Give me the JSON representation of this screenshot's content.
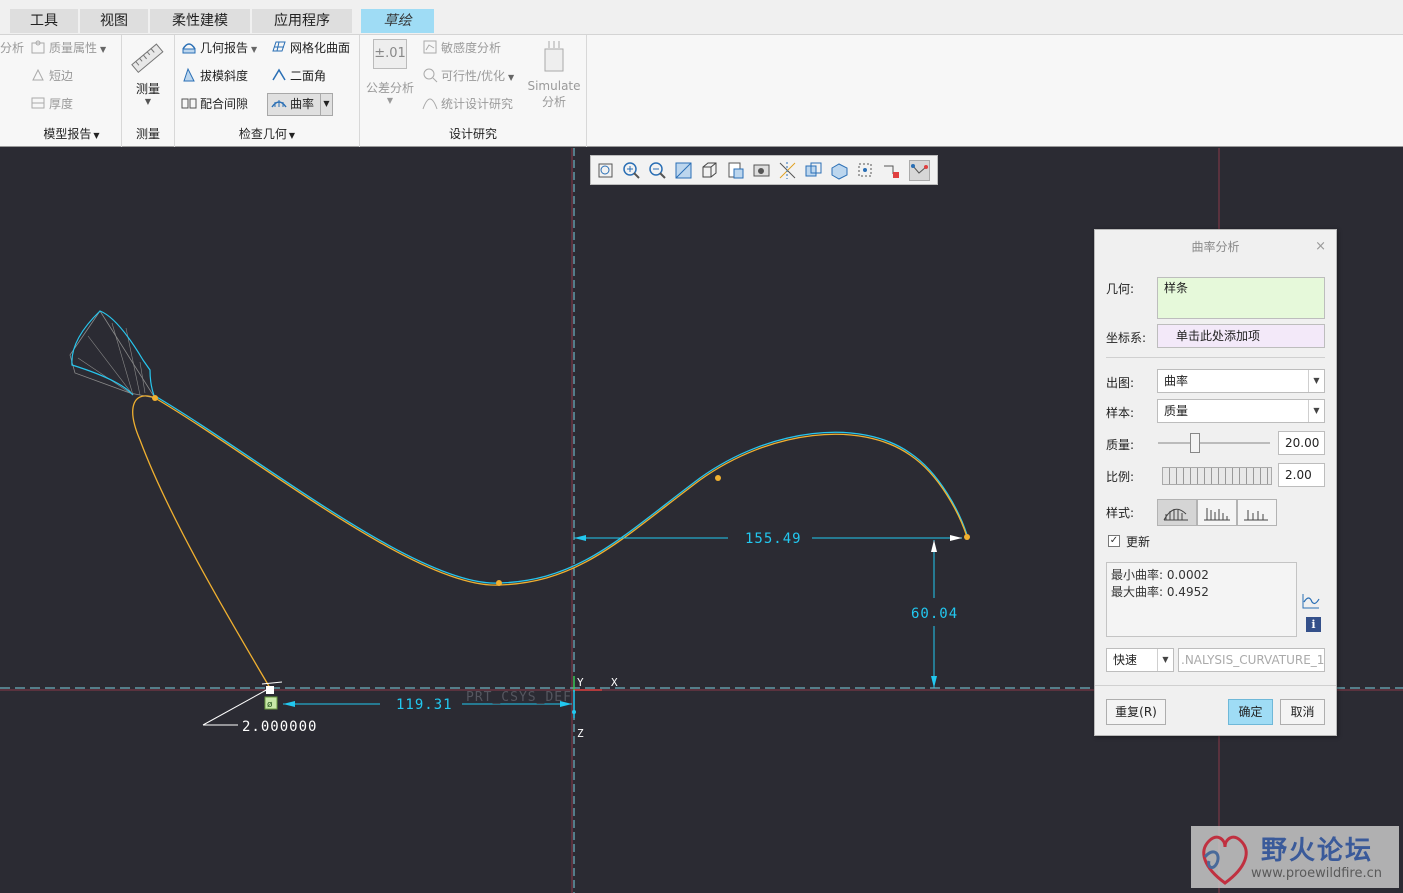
{
  "tabs": [
    {
      "label": "工具"
    },
    {
      "label": "视图"
    },
    {
      "label": "柔性建模"
    },
    {
      "label": "应用程序"
    },
    {
      "label": "草绘"
    }
  ],
  "ribbon": {
    "partial_left": "分析",
    "model_report": {
      "items": [
        "质量属性",
        "短边",
        "厚度"
      ],
      "label": "模型报告"
    },
    "measure": {
      "button": "测量",
      "label": "测量"
    },
    "inspect_geometry": {
      "items": [
        "几何报告",
        "拔模斜度",
        "配合间隙",
        "网格化曲面",
        "二面角",
        "曲率"
      ],
      "label": "检查几何"
    },
    "design_study": {
      "tolerance_icon": "±.01",
      "tolerance": "公差分析",
      "items": [
        "敏感度分析",
        "可行性/优化",
        "统计设计研究"
      ],
      "simulate_line1": "Simulate",
      "simulate_line2": "分析",
      "label": "设计研究"
    }
  },
  "canvas": {
    "dim_horizontal": "155.49",
    "dim_vertical": "60.04",
    "dim_bottom": "119.31",
    "dim_angle": "2.000000",
    "csys_label": "PRT_CSYS_DEF",
    "axis_y": "Y",
    "axis_x": "X",
    "axis_z": "Z"
  },
  "dialog": {
    "title": "曲率分析",
    "close": "×",
    "geometry_label": "几何:",
    "geometry_value": "样条",
    "csys_label": "坐标系:",
    "csys_value": "单击此处添加项",
    "plot_label": "出图:",
    "plot_value": "曲率",
    "sample_label": "样本:",
    "sample_value": "质量",
    "quality_label": "质量:",
    "quality_value": "20.00",
    "quality_level": 0.33,
    "scale_label": "比例:",
    "scale_value": "2.00",
    "style_label": "样式:",
    "update_label": "更新",
    "update_checked": true,
    "min_curvature": "最小曲率: 0.0002",
    "max_curvature": "最大曲率: 0.4952",
    "mode_value": "快速",
    "name_value": ".NALYSIS_CURVATURE_1",
    "repeat_button": "重复(R)",
    "ok_button": "确定",
    "cancel_button": "取消"
  },
  "watermark": {
    "title": "野火论坛",
    "url": "www.proewildfire.cn"
  },
  "colors": {
    "accent": "#9fdcf5",
    "canvas_bg": "#2b2b33",
    "dimension": "#22c8f0",
    "spline": "#f0b030",
    "curvature_comb": "#27c6ee"
  }
}
